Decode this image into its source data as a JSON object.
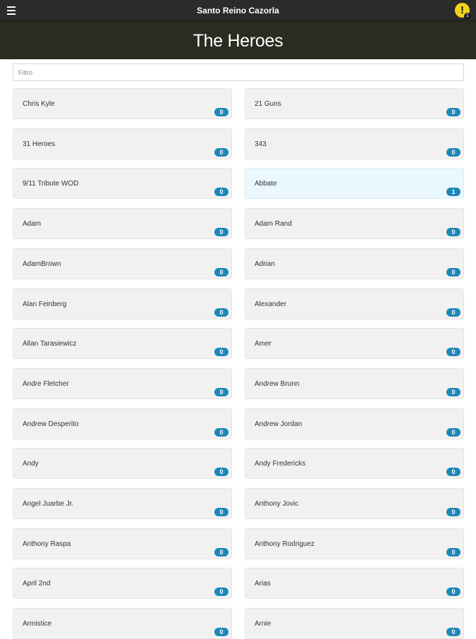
{
  "app": {
    "title": "Santo Reino Cazorla",
    "alert_icon": "!",
    "alert_count": "1"
  },
  "header": {
    "title": "The Heroes"
  },
  "filter": {
    "placeholder": "Filtro",
    "value": ""
  },
  "colors": {
    "topbar": "#2b2b2b",
    "header": "#2c2b21",
    "card": "#f1f1f1",
    "card_highlight": "#eaf7fc",
    "badge": "#1d87b8",
    "alert": "#f2d21b"
  },
  "heroes": [
    {
      "name": "Chris Kyle",
      "count": "0",
      "highlighted": false
    },
    {
      "name": "21 Guns",
      "count": "0",
      "highlighted": false
    },
    {
      "name": "31 Heroes",
      "count": "0",
      "highlighted": false
    },
    {
      "name": "343",
      "count": "0",
      "highlighted": false
    },
    {
      "name": "9/11 Tribute WOD",
      "count": "0",
      "highlighted": false
    },
    {
      "name": "Abbate",
      "count": "1",
      "highlighted": true
    },
    {
      "name": "Adam",
      "count": "0",
      "highlighted": false
    },
    {
      "name": "Adam Rand",
      "count": "0",
      "highlighted": false
    },
    {
      "name": "AdamBrown",
      "count": "0",
      "highlighted": false
    },
    {
      "name": "Adrian",
      "count": "0",
      "highlighted": false
    },
    {
      "name": "Alan Feinberg",
      "count": "0",
      "highlighted": false
    },
    {
      "name": "Alexander",
      "count": "0",
      "highlighted": false
    },
    {
      "name": "Allan Tarasiewicz",
      "count": "0",
      "highlighted": false
    },
    {
      "name": "Amer",
      "count": "0",
      "highlighted": false
    },
    {
      "name": "Andre Fletcher",
      "count": "0",
      "highlighted": false
    },
    {
      "name": "Andrew Brunn",
      "count": "0",
      "highlighted": false
    },
    {
      "name": "Andrew Desperito",
      "count": "0",
      "highlighted": false
    },
    {
      "name": "Andrew Jordan",
      "count": "0",
      "highlighted": false
    },
    {
      "name": "Andy",
      "count": "0",
      "highlighted": false
    },
    {
      "name": "Andy Fredericks",
      "count": "0",
      "highlighted": false
    },
    {
      "name": "Angel Juarbe Jr.",
      "count": "0",
      "highlighted": false
    },
    {
      "name": "Anthony Jovic",
      "count": "0",
      "highlighted": false
    },
    {
      "name": "Anthony Raspa",
      "count": "0",
      "highlighted": false
    },
    {
      "name": "Anthony Rodriguez",
      "count": "0",
      "highlighted": false
    },
    {
      "name": "April 2nd",
      "count": "0",
      "highlighted": false
    },
    {
      "name": "Arias",
      "count": "0",
      "highlighted": false
    },
    {
      "name": "Armistice",
      "count": "0",
      "highlighted": false
    },
    {
      "name": "Arnie",
      "count": "0",
      "highlighted": false
    }
  ]
}
